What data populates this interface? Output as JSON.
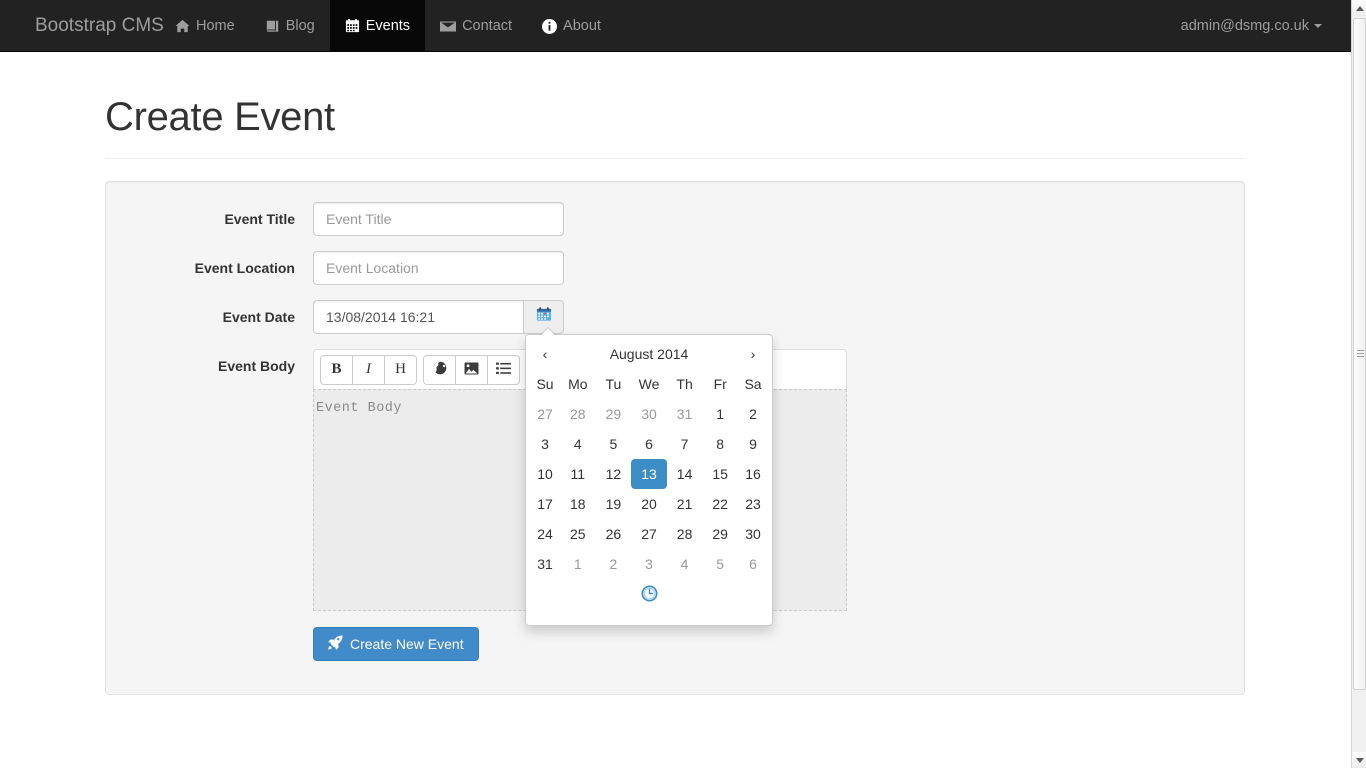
{
  "navbar": {
    "brand": "Bootstrap CMS",
    "items": [
      {
        "label": "Home",
        "icon": "home-icon",
        "active": false
      },
      {
        "label": "Blog",
        "icon": "book-icon",
        "active": false
      },
      {
        "label": "Events",
        "icon": "calendar-icon",
        "active": true
      },
      {
        "label": "Contact",
        "icon": "envelope-icon",
        "active": false
      },
      {
        "label": "About",
        "icon": "info-circle-icon",
        "active": false
      }
    ],
    "user": "admin@dsmg.co.uk"
  },
  "page": {
    "title": "Create Event"
  },
  "form": {
    "title_label": "Event Title",
    "title_placeholder": "Event Title",
    "title_value": "",
    "location_label": "Event Location",
    "location_placeholder": "Event Location",
    "location_value": "",
    "date_label": "Event Date",
    "date_value": "13/08/2014 16:21",
    "date_button_icon": "calendar-icon",
    "body_label": "Event Body",
    "body_placeholder": "Event Body",
    "submit_label": "Create New Event",
    "submit_icon": "rocket-icon"
  },
  "editor_toolbar": {
    "buttons": [
      {
        "name": "bold-button",
        "glyph": "B",
        "icon": "bold-icon"
      },
      {
        "name": "italic-button",
        "glyph": "I",
        "icon": "italic-icon"
      },
      {
        "name": "header-button",
        "glyph": "H",
        "icon": "header-icon"
      },
      {
        "name": "link-button",
        "glyph": "",
        "icon": "globe-icon"
      },
      {
        "name": "image-button",
        "glyph": "",
        "icon": "image-icon"
      },
      {
        "name": "list-button",
        "glyph": "",
        "icon": "list-icon"
      }
    ]
  },
  "datepicker": {
    "prev_label": "‹",
    "next_label": "›",
    "month_title": "August 2014",
    "dow": [
      "Su",
      "Mo",
      "Tu",
      "We",
      "Th",
      "Fr",
      "Sa"
    ],
    "weeks": [
      [
        {
          "d": "27",
          "type": "old"
        },
        {
          "d": "28",
          "type": "old"
        },
        {
          "d": "29",
          "type": "old"
        },
        {
          "d": "30",
          "type": "old"
        },
        {
          "d": "31",
          "type": "old"
        },
        {
          "d": "1",
          "type": "day"
        },
        {
          "d": "2",
          "type": "day"
        }
      ],
      [
        {
          "d": "3",
          "type": "day"
        },
        {
          "d": "4",
          "type": "day"
        },
        {
          "d": "5",
          "type": "day"
        },
        {
          "d": "6",
          "type": "day"
        },
        {
          "d": "7",
          "type": "day"
        },
        {
          "d": "8",
          "type": "day"
        },
        {
          "d": "9",
          "type": "day"
        }
      ],
      [
        {
          "d": "10",
          "type": "day"
        },
        {
          "d": "11",
          "type": "day"
        },
        {
          "d": "12",
          "type": "day"
        },
        {
          "d": "13",
          "type": "active"
        },
        {
          "d": "14",
          "type": "day"
        },
        {
          "d": "15",
          "type": "day"
        },
        {
          "d": "16",
          "type": "day"
        }
      ],
      [
        {
          "d": "17",
          "type": "day"
        },
        {
          "d": "18",
          "type": "day"
        },
        {
          "d": "19",
          "type": "day"
        },
        {
          "d": "20",
          "type": "day"
        },
        {
          "d": "21",
          "type": "day"
        },
        {
          "d": "22",
          "type": "day"
        },
        {
          "d": "23",
          "type": "day"
        }
      ],
      [
        {
          "d": "24",
          "type": "day"
        },
        {
          "d": "25",
          "type": "day"
        },
        {
          "d": "26",
          "type": "day"
        },
        {
          "d": "27",
          "type": "day"
        },
        {
          "d": "28",
          "type": "day"
        },
        {
          "d": "29",
          "type": "day"
        },
        {
          "d": "30",
          "type": "day"
        }
      ],
      [
        {
          "d": "31",
          "type": "day"
        },
        {
          "d": "1",
          "type": "new"
        },
        {
          "d": "2",
          "type": "new"
        },
        {
          "d": "3",
          "type": "new"
        },
        {
          "d": "4",
          "type": "new"
        },
        {
          "d": "5",
          "type": "new"
        },
        {
          "d": "6",
          "type": "new"
        }
      ]
    ],
    "footer_icon": "clock-icon",
    "selected_day": "13",
    "accent_color": "#3c8dc5"
  },
  "colors": {
    "navbar_bg": "#222222",
    "navbar_active_bg": "#080808",
    "primary": "#428bca",
    "panel_bg": "#f5f5f5",
    "text": "#333333"
  }
}
